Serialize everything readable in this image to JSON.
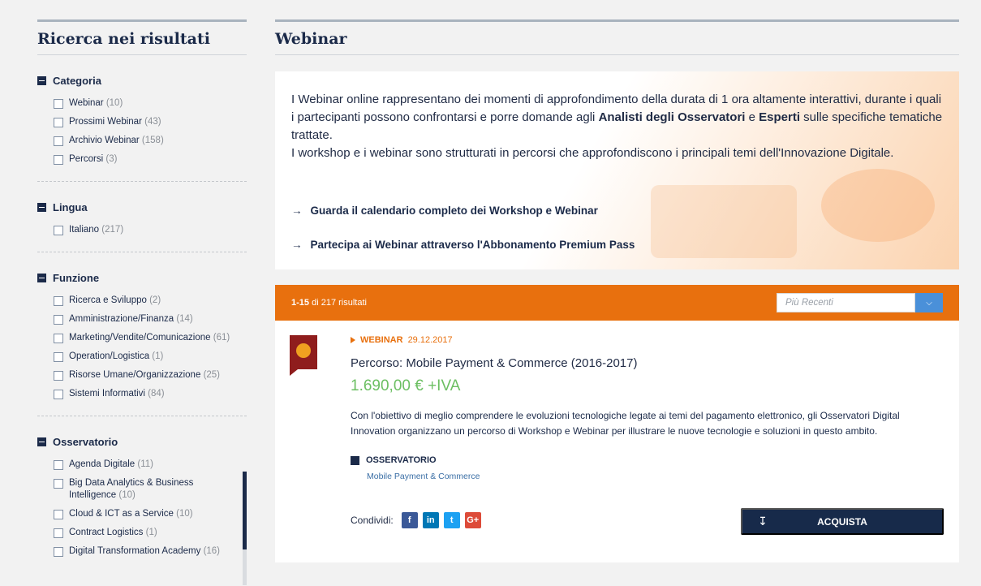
{
  "sidebar": {
    "title": "Ricerca nei risultati",
    "facets": [
      {
        "name": "Categoria",
        "items": [
          {
            "label": "Webinar",
            "count": "(10)"
          },
          {
            "label": "Prossimi Webinar",
            "count": "(43)"
          },
          {
            "label": "Archivio Webinar",
            "count": "(158)"
          },
          {
            "label": "Percorsi",
            "count": "(3)"
          }
        ]
      },
      {
        "name": "Lingua",
        "items": [
          {
            "label": "Italiano",
            "count": "(217)"
          }
        ]
      },
      {
        "name": "Funzione",
        "items": [
          {
            "label": "Ricerca e Sviluppo",
            "count": "(2)"
          },
          {
            "label": "Amministrazione/Finanza",
            "count": "(14)"
          },
          {
            "label": "Marketing/Vendite/Comunicazione",
            "count": "(61)"
          },
          {
            "label": "Operation/Logistica",
            "count": "(1)"
          },
          {
            "label": "Risorse Umane/Organizzazione",
            "count": "(25)"
          },
          {
            "label": "Sistemi Informativi",
            "count": "(84)"
          }
        ]
      },
      {
        "name": "Osservatorio",
        "items": [
          {
            "label": "Agenda Digitale",
            "count": "(11)"
          },
          {
            "label": "Big Data Analytics & Business Intelligence",
            "count": "(10)"
          },
          {
            "label": "Cloud & ICT as a Service",
            "count": "(10)"
          },
          {
            "label": "Contract Logistics",
            "count": "(1)"
          },
          {
            "label": "Digital Transformation Academy",
            "count": "(16)"
          }
        ]
      }
    ]
  },
  "main": {
    "title": "Webinar",
    "intro": {
      "p1_a": "I Webinar online rappresentano dei momenti di approfondimento della durata di 1 ora altamente interattivi, durante i quali i partecipanti possono confrontarsi e porre domande agli ",
      "p1_b1": "Analisti degli Osservatori",
      "p1_mid": " e ",
      "p1_b2": "Esperti",
      "p1_c": " sulle specifiche tematiche trattate.",
      "p2": "I workshop e i webinar sono strutturati in percorsi che approfondiscono i principali temi dell'Innovazione Digitale.",
      "link1": "Guarda il calendario completo dei Workshop e Webinar",
      "link2": "Partecipa ai Webinar attraverso l'Abbonamento Premium Pass",
      "arrow": "→"
    },
    "results": {
      "range": "1-15",
      "rest": " di 217 risultati",
      "sort_placeholder": "Più Recenti"
    },
    "card": {
      "kind": "WEBINAR",
      "date": " 29.12.2017",
      "title": "Percorso: Mobile Payment & Commerce (2016-2017)",
      "price": "1.690,00 € +IVA",
      "description": "Con l'obiettivo di meglio comprendere le evoluzioni tecnologiche legate ai temi del pagamento elettronico, gli Osservatori Digital Innovation organizzano un percorso di Workshop e Webinar per illustrare le nuove tecnologie e soluzioni in questo ambito.",
      "osservatorio_label": "OSSERVATORIO",
      "osservatorio_value": "Mobile Payment & Commerce",
      "share_label": "Condividi:",
      "share": {
        "fb": "f",
        "li": "in",
        "tw": "t",
        "gp": "G+"
      },
      "buy_label": "ACQUISTA"
    }
  },
  "colors": {
    "accent": "#e8700e",
    "navy": "#1b2a49",
    "price": "#6cbf62"
  }
}
